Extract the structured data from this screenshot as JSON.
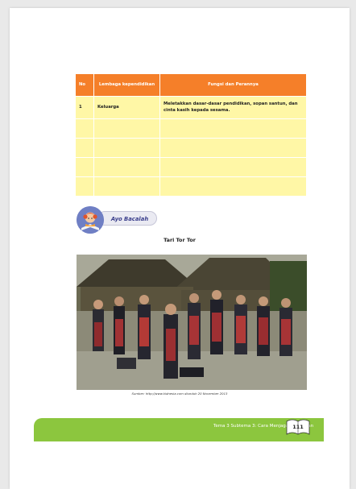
{
  "table": {
    "headers": [
      "No",
      "Lembaga kependidikan",
      "Fungsi dan Perannya"
    ],
    "rows": [
      [
        "1",
        "Keluarga",
        "Meletakkan dasar-dasar pendidikan, sopan santun, dan cinta kasih kepada sesama."
      ],
      [
        "",
        "",
        ""
      ],
      [
        "",
        "",
        ""
      ],
      [
        "",
        "",
        ""
      ],
      [
        "",
        "",
        ""
      ]
    ]
  },
  "ayo_bacalah": {
    "label": "Ayo Bacalah",
    "icon": "reading-child-icon"
  },
  "reading_title": "Tari Tor Tor",
  "photo": {
    "icon": "tor-tor-dance-photo"
  },
  "caption": "Sumber: http://www.kidnesia.com diunduh 20 November 2013",
  "footer": {
    "text": "Tema 3 Subtema 3: Cara Menjaga Kerukunan",
    "page_number": "111"
  },
  "colors": {
    "header_orange": "#f57f29",
    "row_yellow": "#fff7a6",
    "footer_green": "#8cc63e"
  }
}
